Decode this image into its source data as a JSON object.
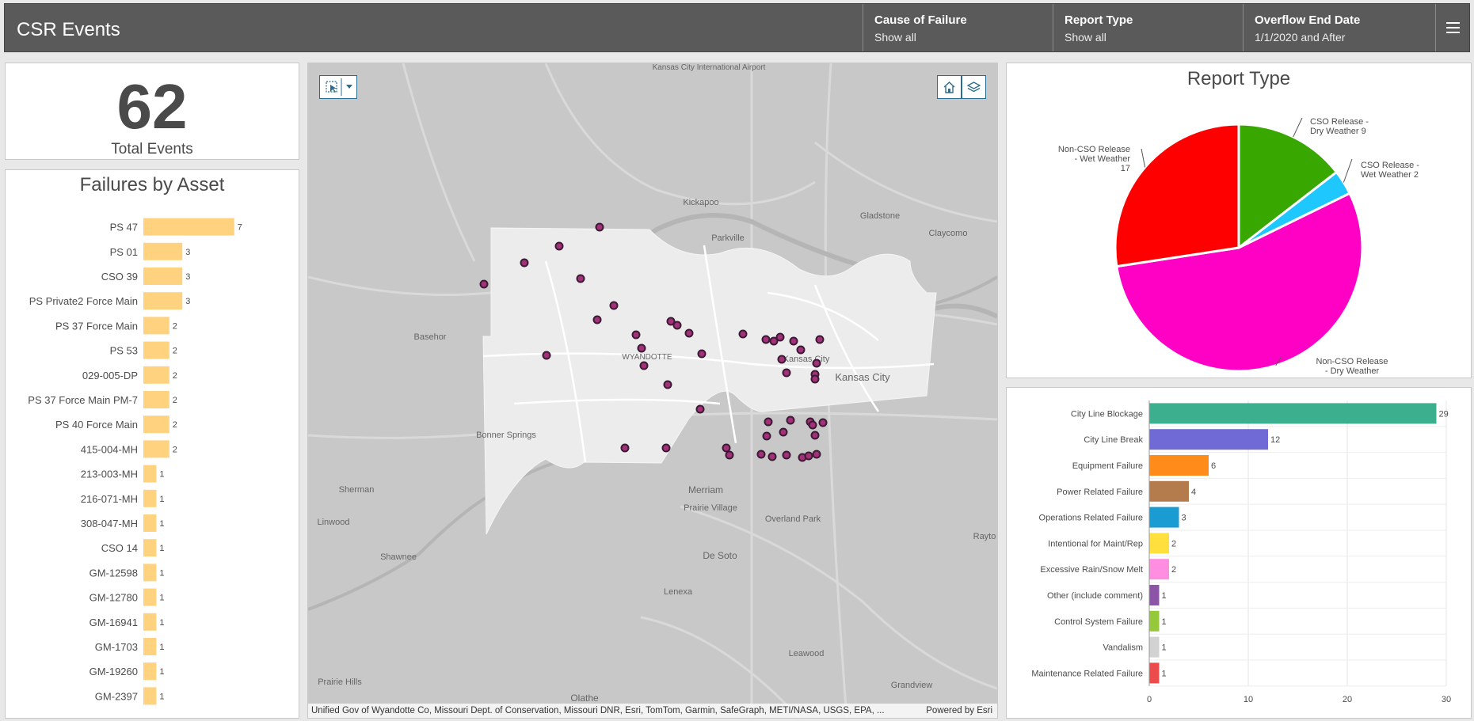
{
  "app": {
    "title": "CSR Events"
  },
  "header": {
    "selectors": [
      {
        "label": "Cause of Failure",
        "value": "Show all"
      },
      {
        "label": "Report Type",
        "value": "Show all"
      },
      {
        "label": "Overflow End Date",
        "value": "1/1/2020 and After"
      }
    ],
    "menu_icon": "hamburger-menu-icon"
  },
  "total": {
    "value": "62",
    "label": "Total Events"
  },
  "failures_by_asset": {
    "title": "Failures by Asset",
    "color": "#ffd27f",
    "chart_data": {
      "type": "bar",
      "orientation": "horizontal",
      "categories": [
        "PS 47",
        "PS 01",
        "CSO 39",
        "PS Private2 Force Main",
        "PS 37 Force Main",
        "PS 53",
        "029-005-DP",
        "PS 37 Force Main PM-7",
        "PS 40 Force Main",
        "415-004-MH",
        "213-003-MH",
        "216-071-MH",
        "308-047-MH",
        "CSO 14",
        "GM-12598",
        "GM-12780",
        "GM-16941",
        "GM-1703",
        "GM-19260",
        "GM-2397"
      ],
      "values": [
        7,
        3,
        3,
        3,
        2,
        2,
        2,
        2,
        2,
        2,
        1,
        1,
        1,
        1,
        1,
        1,
        1,
        1,
        1,
        1
      ]
    }
  },
  "map": {
    "place_labels": [
      {
        "text": "Kansas City International Airport"
      },
      {
        "text": "Kickapoo"
      },
      {
        "text": "Parkville"
      },
      {
        "text": "Gladstone"
      },
      {
        "text": "Claycomo"
      },
      {
        "text": "Basehor"
      },
      {
        "text": "WYANDOTTE"
      },
      {
        "text": "Kansas City"
      },
      {
        "text": "Kansas City"
      },
      {
        "text": "Bonner Springs"
      },
      {
        "text": "Sherman"
      },
      {
        "text": "Linwood"
      },
      {
        "text": "Shawnee"
      },
      {
        "text": "Merriam"
      },
      {
        "text": "Prairie Village"
      },
      {
        "text": "Overland Park"
      },
      {
        "text": "De Soto"
      },
      {
        "text": "Lenexa"
      },
      {
        "text": "Rayto"
      },
      {
        "text": "Leawood"
      },
      {
        "text": "Prairie Hills"
      },
      {
        "text": "Grandview"
      },
      {
        "text": "Olathe"
      }
    ],
    "attribution": "Unified Gov of Wyandotte Co, Missouri Dept. of Conservation, Missouri DNR, Esri, TomTom, Garmin, SafeGraph, METI/NASA, USGS, EPA, ...",
    "powered_by": "Powered by Esri",
    "tools": {
      "select_icon": "select-tool-icon",
      "dropdown_icon": "chevron-down-icon",
      "home_icon": "home-icon",
      "layers_icon": "layers-icon"
    },
    "colors": {
      "point_fill": "#a2317a",
      "point_stroke": "#3b1b33"
    }
  },
  "report_type": {
    "title": "Report Type",
    "chart_data": {
      "type": "pie",
      "slices": [
        {
          "name": "CSO Release - Dry Weather",
          "value": 9,
          "color": "#38a800"
        },
        {
          "name": "CSO Release - Wet Weather",
          "value": 2,
          "color": "#1ec8ff"
        },
        {
          "name": "Non-CSO Release - Dry Weather",
          "value": 34,
          "color": "#ff00c5"
        },
        {
          "name": "Non-CSO Release - Wet Weather",
          "value": 17,
          "color": "#ff0000"
        }
      ],
      "labels": [
        {
          "lines": [
            "CSO Release -",
            "Dry Weather 9"
          ]
        },
        {
          "lines": [
            "CSO Release -",
            "Wet Weather 2"
          ]
        },
        {
          "lines": [
            "Non-CSO Release",
            "- Dry Weather"
          ]
        },
        {
          "lines": [
            "Non-CSO Release",
            "- Wet Weather",
            "17"
          ]
        }
      ]
    }
  },
  "cause_of_failure": {
    "chart_data": {
      "type": "bar",
      "orientation": "horizontal",
      "categories": [
        "City Line Blockage",
        "City Line Break",
        "Equipment Failure",
        "Power Related Failure",
        "Operations Related Failure",
        "Intentional for Maint/Rep",
        "Excessive Rain/Snow Melt",
        "Other (include comment)",
        "Control System Failure",
        "Vandalism",
        "Maintenance Related Failure"
      ],
      "values": [
        29,
        12,
        6,
        4,
        3,
        2,
        2,
        1,
        1,
        1,
        1
      ],
      "colors": [
        "#3cb08e",
        "#6f6ad6",
        "#ff8c1a",
        "#b47b4c",
        "#1a9bd1",
        "#ffe03c",
        "#ff8ee0",
        "#8c54a6",
        "#96c83c",
        "#d2d2d2",
        "#ec4b4b"
      ],
      "xlim": [
        0,
        30
      ],
      "xticks": [
        0,
        10,
        20,
        30
      ]
    }
  }
}
